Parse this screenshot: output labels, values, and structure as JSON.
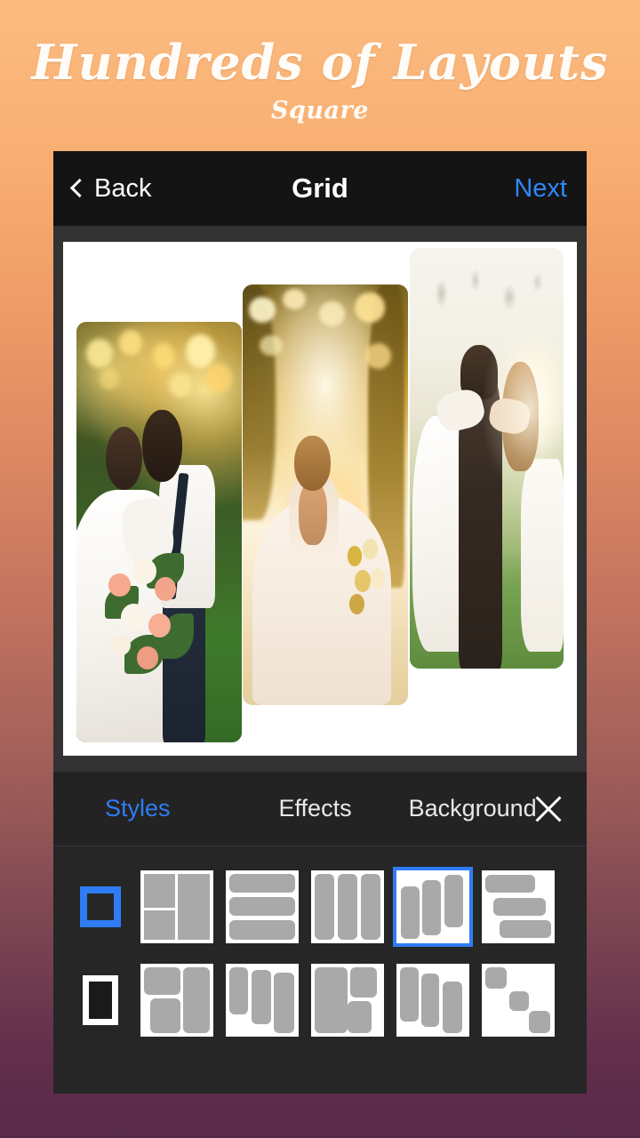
{
  "promo": {
    "title": "Hundreds of Layouts",
    "subtitle": "Square"
  },
  "colors": {
    "accent_blue": "#2F7CF6",
    "bg_top": "#FCBC80",
    "bg_bottom": "#58294A",
    "panel_dark": "#262626",
    "navbar_dark": "#141414",
    "canvas_white": "#FFFFFF",
    "thumb_cell_gray": "#A9A9A9"
  },
  "navbar": {
    "back_label": "Back",
    "back_icon": "chevron-left-icon",
    "title": "Grid",
    "next_label": "Next"
  },
  "canvas": {
    "background": "#FFFFFF",
    "photos": [
      {
        "id": "photo-1",
        "description": "Bride and groom embracing at golden hour sunset, bride holding large pink and white floral bouquet"
      },
      {
        "id": "photo-2",
        "description": "Bride seen from behind in open-back lace ball gown, backlit by sun through trees"
      },
      {
        "id": "photo-3",
        "description": "Couple seen from behind embracing in a sunlit grassy field, hazy warm light"
      }
    ]
  },
  "tabs": {
    "items": [
      {
        "label": "Styles",
        "active": true
      },
      {
        "label": "Effects",
        "active": false
      },
      {
        "label": "Background",
        "active": false
      }
    ],
    "close_icon": "close-icon"
  },
  "picker": {
    "rows": [
      {
        "ratio_label": "square-ratio",
        "ratio_icon": "square-outline-icon",
        "ratio_selected": true,
        "layouts": [
          {
            "name": "layout-left-split-right-tall",
            "selected": false
          },
          {
            "name": "layout-three-rows",
            "selected": false
          },
          {
            "name": "layout-three-columns",
            "selected": false
          },
          {
            "name": "layout-three-staggered-columns",
            "selected": true
          },
          {
            "name": "layout-three-staggered-rows",
            "selected": false
          }
        ]
      },
      {
        "ratio_label": "portrait-ratio",
        "ratio_icon": "portrait-outline-icon",
        "ratio_selected": false,
        "layouts": [
          {
            "name": "layout-top-left-large-right-tall",
            "selected": false
          },
          {
            "name": "layout-three-descending-columns",
            "selected": false
          },
          {
            "name": "layout-left-tall-right-two",
            "selected": false
          },
          {
            "name": "layout-three-cascading-columns",
            "selected": false
          },
          {
            "name": "layout-three-diagonal-squares",
            "selected": false
          }
        ]
      }
    ]
  }
}
